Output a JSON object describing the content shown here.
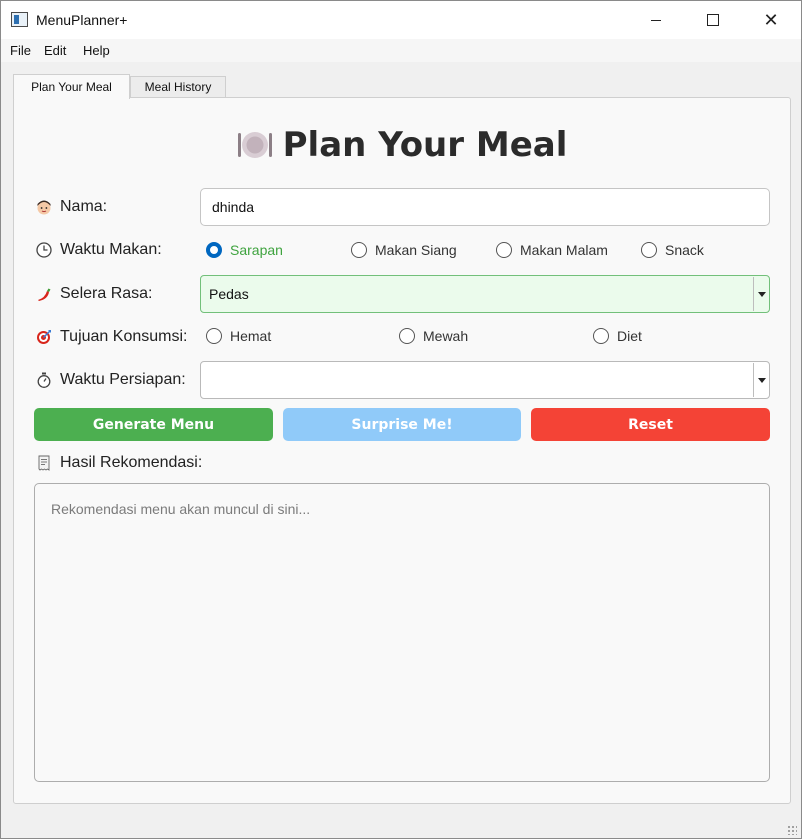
{
  "window": {
    "title": "MenuPlanner+"
  },
  "menubar": {
    "items": [
      "File",
      "Edit",
      "Help"
    ]
  },
  "tabs": [
    {
      "label": "Plan Your Meal",
      "active": true
    },
    {
      "label": "Meal History",
      "active": false
    }
  ],
  "heading": {
    "icon": "plate-cutlery-icon",
    "text": "Plan Your Meal"
  },
  "form": {
    "nama": {
      "label": "Nama:",
      "icon": "person-face-icon",
      "value": "dhinda"
    },
    "waktu_makan": {
      "label": "Waktu Makan:",
      "icon": "clock-icon",
      "options": [
        "Sarapan",
        "Makan Siang",
        "Makan Malam",
        "Snack"
      ],
      "selected": "Sarapan"
    },
    "selera_rasa": {
      "label": "Selera Rasa:",
      "icon": "chili-pepper-icon",
      "value": "Pedas"
    },
    "tujuan_konsumsi": {
      "label": "Tujuan Konsumsi:",
      "icon": "target-dart-icon",
      "options": [
        "Hemat",
        "Mewah",
        "Diet"
      ],
      "selected": null
    },
    "waktu_persiapan": {
      "label": "Waktu Persiapan:",
      "icon": "stopwatch-icon",
      "value": ""
    }
  },
  "buttons": {
    "generate": "Generate Menu",
    "surprise": "Surprise Me!",
    "reset": "Reset"
  },
  "result": {
    "label": "Hasil Rekomendasi:",
    "icon": "receipt-icon",
    "placeholder": "Rekomendasi menu akan muncul di sini..."
  },
  "colors": {
    "generate": "#4caf50",
    "surprise": "#90caf9",
    "reset": "#f44336",
    "selected_radio_text": "#3fa33f",
    "radio_accent": "#0067c0",
    "selera_field_bg": "#ebfbec"
  }
}
